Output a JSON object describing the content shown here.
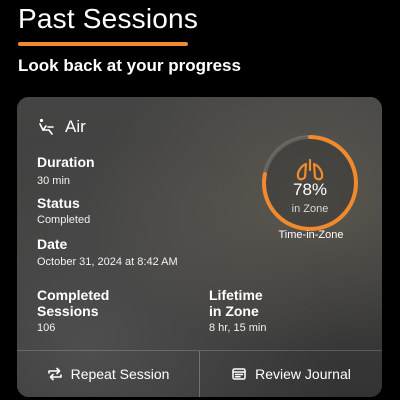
{
  "page": {
    "title": "Past Sessions",
    "subtitle": "Look back at your progress",
    "accent_color": "#f08a2c"
  },
  "session": {
    "name": "Air",
    "icon": "seat-recline-icon",
    "fields": {
      "duration_label": "Duration",
      "duration_value": "30 min",
      "status_label": "Status",
      "status_value": "Completed",
      "date_label": "Date",
      "date_value": "October 31, 2024 at 8:42 AM",
      "completed_label_line1": "Completed",
      "completed_label_line2": "Sessions",
      "completed_value": "106",
      "lifetime_label_line1": "Lifetime",
      "lifetime_label_line2": "in Zone",
      "lifetime_value": "8 hr, 15 min"
    },
    "time_in_zone": {
      "percent": 0.78,
      "percent_text": "78%",
      "sub_label": "in Zone",
      "caption": "Time-in-Zone",
      "icon": "lungs-icon"
    }
  },
  "actions": {
    "repeat_label": "Repeat Session",
    "repeat_icon": "repeat-icon",
    "journal_label": "Review Journal",
    "journal_icon": "journal-icon"
  }
}
